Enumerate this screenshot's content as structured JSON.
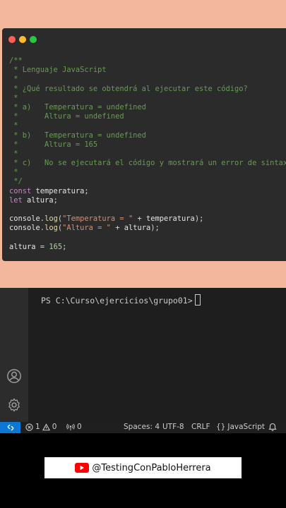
{
  "code_lines": [
    [
      {
        "t": "/**",
        "c": "cm"
      }
    ],
    [
      {
        "t": " * Lenguaje JavaScript",
        "c": "cm"
      }
    ],
    [
      {
        "t": " *",
        "c": "cm"
      }
    ],
    [
      {
        "t": " * ¿Qué resultado se obtendrá al ejecutar este código?",
        "c": "cm"
      }
    ],
    [
      {
        "t": " *",
        "c": "cm"
      }
    ],
    [
      {
        "t": " * a)   Temperatura = undefined",
        "c": "cm"
      }
    ],
    [
      {
        "t": " *      Altura = undefined",
        "c": "cm"
      }
    ],
    [
      {
        "t": " *",
        "c": "cm"
      }
    ],
    [
      {
        "t": " * b)   Temperatura = undefined",
        "c": "cm"
      }
    ],
    [
      {
        "t": " *      Altura = 165",
        "c": "cm"
      }
    ],
    [
      {
        "t": " *",
        "c": "cm"
      }
    ],
    [
      {
        "t": " * c)   No se ejecutará el código y mostrará un error de sintaxis",
        "c": "cm"
      }
    ],
    [
      {
        "t": " *",
        "c": "cm"
      }
    ],
    [
      {
        "t": " */",
        "c": "cm"
      }
    ],
    [
      {
        "t": "const",
        "c": "kw"
      },
      {
        "t": " temperatura",
        "c": "var"
      },
      {
        "t": ";",
        "c": "plain"
      }
    ],
    [
      {
        "t": "let",
        "c": "kw"
      },
      {
        "t": " altura",
        "c": "var"
      },
      {
        "t": ";",
        "c": "plain"
      }
    ],
    [],
    [
      {
        "t": "console",
        "c": "var"
      },
      {
        "t": ".",
        "c": "plain"
      },
      {
        "t": "log",
        "c": "fn"
      },
      {
        "t": "(",
        "c": "plain"
      },
      {
        "t": "\"Temperatura = \"",
        "c": "str"
      },
      {
        "t": " + ",
        "c": "plain"
      },
      {
        "t": "temperatura",
        "c": "var"
      },
      {
        "t": ");",
        "c": "plain"
      }
    ],
    [
      {
        "t": "console",
        "c": "var"
      },
      {
        "t": ".",
        "c": "plain"
      },
      {
        "t": "log",
        "c": "fn"
      },
      {
        "t": "(",
        "c": "plain"
      },
      {
        "t": "\"Altura = \"",
        "c": "str"
      },
      {
        "t": " + ",
        "c": "plain"
      },
      {
        "t": "altura",
        "c": "var"
      },
      {
        "t": ");",
        "c": "plain"
      }
    ],
    [],
    [
      {
        "t": "altura",
        "c": "var"
      },
      {
        "t": " = ",
        "c": "plain"
      },
      {
        "t": "165",
        "c": "num"
      },
      {
        "t": ";",
        "c": "plain"
      }
    ]
  ],
  "terminal": {
    "prompt": "PS C:\\Curso\\ejercicios\\grupo01>"
  },
  "activity_bar": {
    "icons": [
      "account-icon",
      "gear-icon"
    ]
  },
  "status_bar": {
    "remote_icon": "remote-icon",
    "errors": "1",
    "warnings": "0",
    "ports": "0",
    "spaces": "Spaces: 4",
    "encoding": "UTF-8",
    "eol": "CRLF",
    "language": "JavaScript"
  },
  "banner": {
    "text": "@TestingConPabloHerrera",
    "icon": "youtube-icon"
  },
  "colors": {
    "background_top": "#f2b79c",
    "editor_bg": "#2b2b2b",
    "comment": "#6a9955",
    "keyword": "#c586c0",
    "string": "#ce9178",
    "number": "#b5cea8",
    "status_accent": "#0a78d4"
  }
}
